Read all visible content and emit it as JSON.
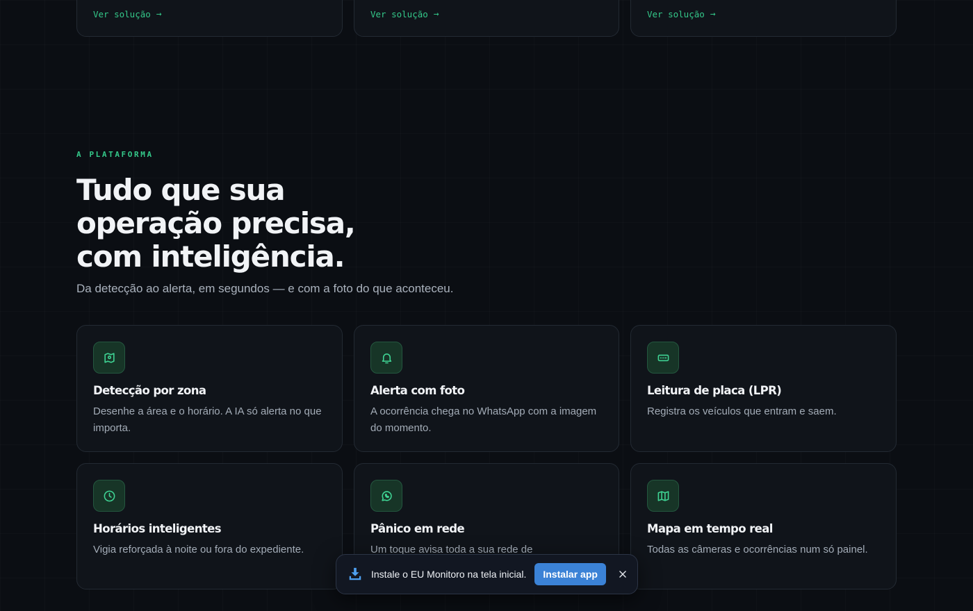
{
  "solutions_row": {
    "cards": [
      {
        "link_label": "Ver solução",
        "arrow": "→"
      },
      {
        "link_label": "Ver solução",
        "arrow": "→"
      },
      {
        "link_label": "Ver solução",
        "arrow": "→"
      }
    ]
  },
  "platform": {
    "eyebrow": "A PLATAFORMA",
    "headline_lines": [
      "Tudo que sua",
      "operação precisa,",
      "com inteligência."
    ],
    "subtitle": "Da detecção ao alerta, em segundos — e com a foto do que aconteceu.",
    "features": [
      {
        "icon": "map-pin-zone-icon",
        "title": "Detecção por zona",
        "description": "Desenhe a área e o horário. A IA só alerta no que importa."
      },
      {
        "icon": "bell-icon",
        "title": "Alerta com foto",
        "description": "A ocorrência chega no WhatsApp com a imagem do momento."
      },
      {
        "icon": "license-plate-icon",
        "title": "Leitura de placa (LPR)",
        "description": "Registra os veículos que entram e saem."
      },
      {
        "icon": "clock-icon",
        "title": "Horários inteligentes",
        "description": "Vigia reforçada à noite ou fora do expediente."
      },
      {
        "icon": "whatsapp-icon",
        "title": "Pânico em rede",
        "description": "Um toque avisa toda a sua rede de"
      },
      {
        "icon": "map-icon",
        "title": "Mapa em tempo real",
        "description": "Todas as câmeras e ocorrências num só painel."
      }
    ]
  },
  "install_prompt": {
    "icon": "download-icon",
    "message": "Instale o EU Monitoro na tela inicial.",
    "button_label": "Instalar app",
    "close_icon": "close-icon"
  },
  "colors": {
    "background": "#0b0e13",
    "card": "#10141a",
    "accent": "#34c98a",
    "button": "#3b82d6"
  }
}
